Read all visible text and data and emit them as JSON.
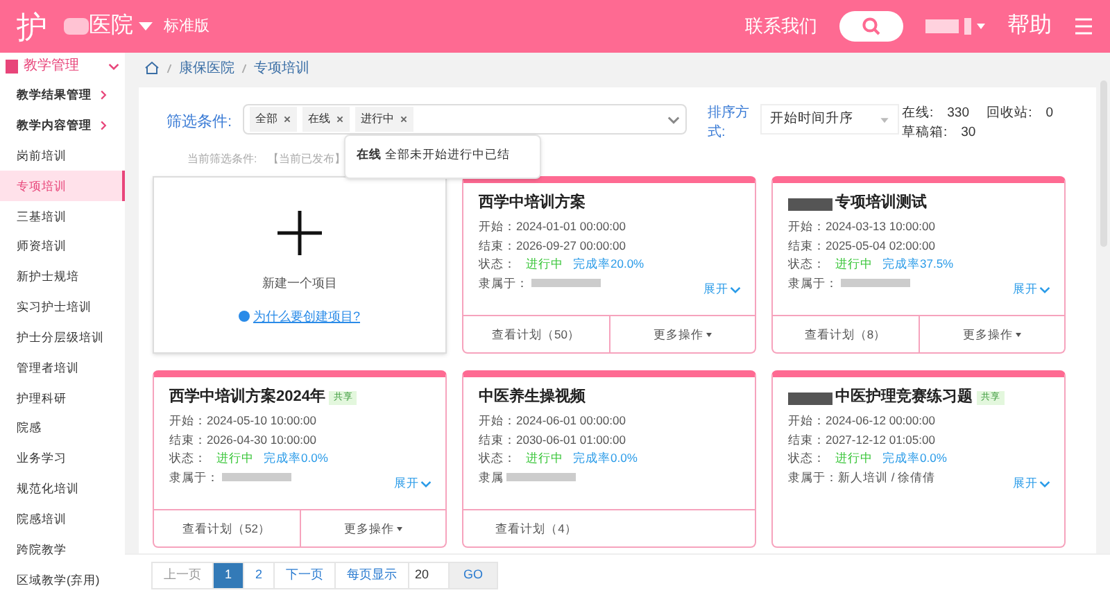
{
  "header": {
    "logo": "护",
    "hospital": "医院",
    "edition": "标准版",
    "contact": "联系我们",
    "help": "帮助"
  },
  "sidebar": {
    "section": {
      "label": "教学管理",
      "expanded": true
    },
    "items": [
      {
        "label": "教学结果管理",
        "has_children": true,
        "selected": false
      },
      {
        "label": "教学内容管理",
        "has_children": true,
        "selected": false
      },
      {
        "label": "岗前培训",
        "selected": false
      },
      {
        "label": "专项培训",
        "selected": true
      },
      {
        "label": "三基培训",
        "selected": false
      },
      {
        "label": "师资培训",
        "selected": false
      },
      {
        "label": "新护士规培",
        "selected": false
      },
      {
        "label": "实习护士培训",
        "selected": false
      },
      {
        "label": "护士分层级培训",
        "selected": false
      },
      {
        "label": "管理者培训",
        "selected": false
      },
      {
        "label": "护理科研",
        "selected": false
      },
      {
        "label": "院感",
        "selected": false
      },
      {
        "label": "业务学习",
        "selected": false
      },
      {
        "label": "规范化培训",
        "selected": false
      },
      {
        "label": "院感培训",
        "selected": false
      },
      {
        "label": "跨院教学",
        "selected": false
      },
      {
        "label": "区域教学(弃用)",
        "selected": false
      }
    ]
  },
  "breadcrumb": [
    "康保医院",
    "专项培训"
  ],
  "filter": {
    "label": "筛选条件:",
    "tags": [
      "全部",
      "在线",
      "进行中"
    ],
    "hint": "当前筛选条件:　【当前已发布】",
    "popup": {
      "bold": "在线",
      "text": "全部未开始进行中已结"
    }
  },
  "sort": {
    "label": "排序方式:",
    "value": "开始时间升序"
  },
  "stats": "在线:　330　 回收站:　0　 草稿箱:　30",
  "new_card": {
    "label": "新建一个项目",
    "link": "为什么要创建项目?"
  },
  "cards": [
    {
      "title": "西学中培训方案",
      "start": "开始：2024-01-01 00:00:00",
      "end": "结束：2026-09-27 00:00:00",
      "status_label": "状态：",
      "status": "进行中",
      "rate": "完成率20.0%",
      "owner": "隶属于：",
      "owner_redacted": true,
      "expand": "展开",
      "buttons": [
        "查看计划（50）",
        "更多操作"
      ]
    },
    {
      "title": "专项培训测试",
      "redacted_prefix": true,
      "start": "开始：2024-03-13 10:00:00",
      "end": "结束：2025-05-04 02:00:00",
      "status_label": "状态：",
      "status": "进行中",
      "rate": "完成率37.5%",
      "owner": "隶属于：",
      "owner_redacted": true,
      "expand": "展开",
      "buttons": [
        "查看计划（8）",
        "更多操作"
      ]
    },
    {
      "title": "西学中培训方案2024年",
      "shared": true,
      "shared_label": "共享",
      "start": "开始：2024-05-10 10:00:00",
      "end": "结束：2026-04-30 10:00:00",
      "status_label": "状态：",
      "status": "进行中",
      "rate": "完成率0.0%",
      "owner": "隶属于：",
      "owner_redacted": true,
      "expand": "展开",
      "buttons": [
        "查看计划（52）",
        "更多操作"
      ]
    },
    {
      "title": "中医养生操视频",
      "start": "开始：2024-06-01 00:00:00",
      "end": "结束：2030-06-01 01:00:00",
      "status_label": "状态：",
      "status": "进行中",
      "rate": "完成率0.0%",
      "owner": "隶属",
      "owner_redacted": true,
      "buttons": [
        "查看计划（4）"
      ]
    },
    {
      "title": "中医护理竞赛练习题",
      "redacted_prefix": true,
      "shared": true,
      "shared_label": "共享",
      "start": "开始：2024-06-12 00:00:00",
      "end": "结束：2027-12-12 01:05:00",
      "status_label": "状态：",
      "status": "进行中",
      "rate": "完成率0.0%",
      "owner": "隶属于：新人培训 / 徐倩倩",
      "expand": "展开"
    }
  ],
  "pagination": {
    "prev": "上一页",
    "pages": [
      {
        "label": "1",
        "selected": true
      },
      {
        "label": "2",
        "selected": false
      }
    ],
    "next": "下一页",
    "per_page": "每页显示",
    "size": "20",
    "go": "GO"
  }
}
